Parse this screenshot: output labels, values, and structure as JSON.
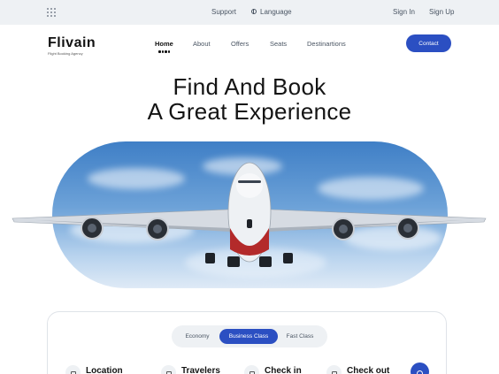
{
  "topbar": {
    "support": "Support",
    "language": "Language",
    "sign_in": "Sign In",
    "sign_up": "Sign Up"
  },
  "brand": {
    "name": "Flivain",
    "tagline": "Flight Booking Agency"
  },
  "nav": {
    "items": [
      "Home",
      "About",
      "Offers",
      "Seats",
      "Destinartions"
    ],
    "active": "Home",
    "contact": "Contact"
  },
  "hero": {
    "line1": "Find And Book",
    "line2": "A Great Experience"
  },
  "booking": {
    "classes": [
      "Economy",
      "Business Class",
      "Fast Class"
    ],
    "selected_class": "Business Class",
    "fields": [
      "Location",
      "Travelers",
      "Check in",
      "Check out"
    ]
  },
  "colors": {
    "accent": "#2b4fc2",
    "topbar_bg": "#eef1f4"
  },
  "icons": {
    "menu": "grid-icon",
    "language": "globe-icon",
    "search": "search-icon"
  }
}
